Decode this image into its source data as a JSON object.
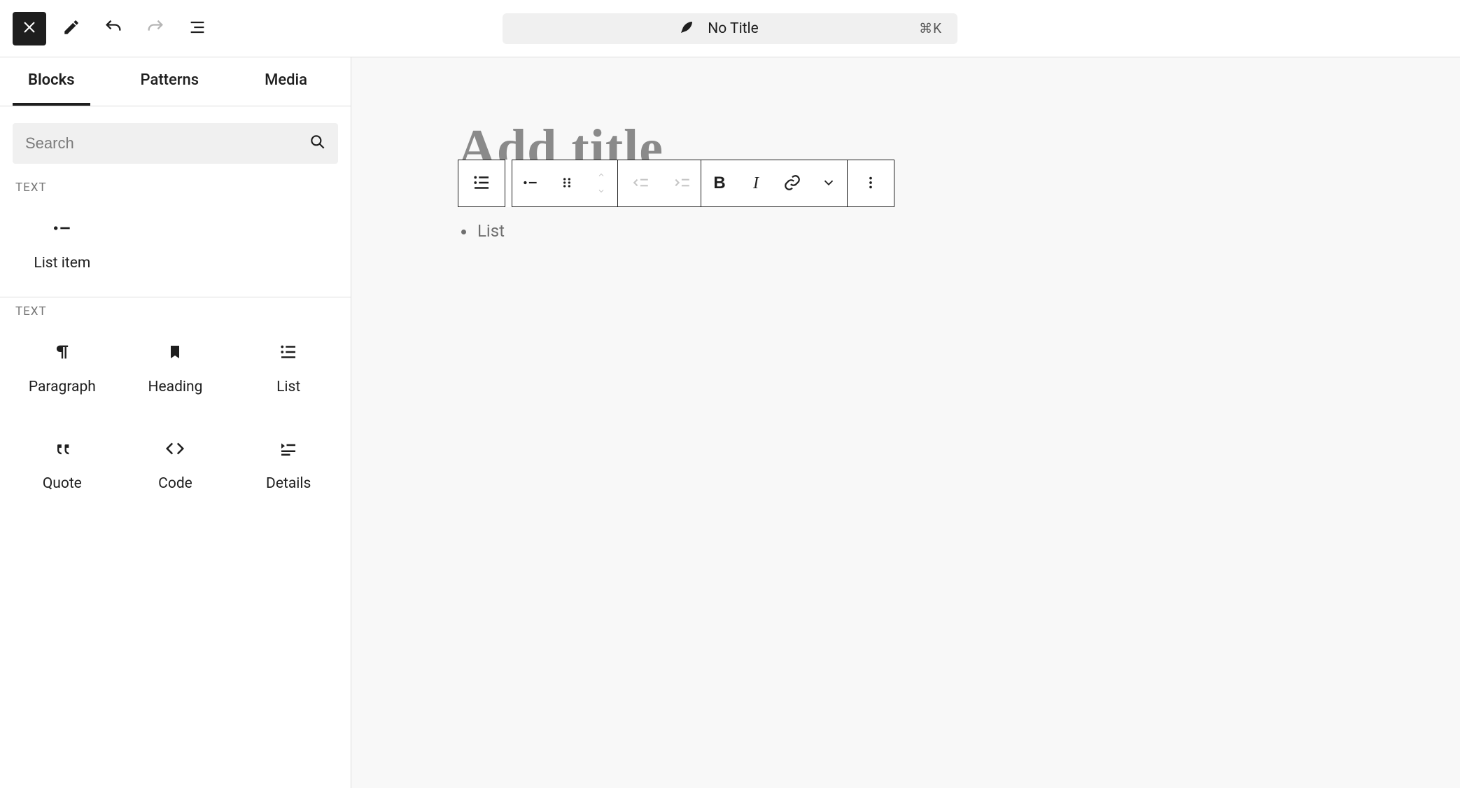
{
  "header": {
    "doc_title": "No Title",
    "kbd_hint": "⌘K"
  },
  "inserter": {
    "tabs": {
      "blocks": "Blocks",
      "patterns": "Patterns",
      "media": "Media"
    },
    "search_placeholder": "Search",
    "section_a_label": "TEXT",
    "section_a_items": {
      "list_item": "List item"
    },
    "section_b_label": "TEXT",
    "section_b_items": {
      "paragraph": "Paragraph",
      "heading": "Heading",
      "list": "List",
      "quote": "Quote",
      "code": "Code",
      "details": "Details"
    }
  },
  "canvas": {
    "title_placeholder": "Add title",
    "list_placeholder": "List"
  }
}
